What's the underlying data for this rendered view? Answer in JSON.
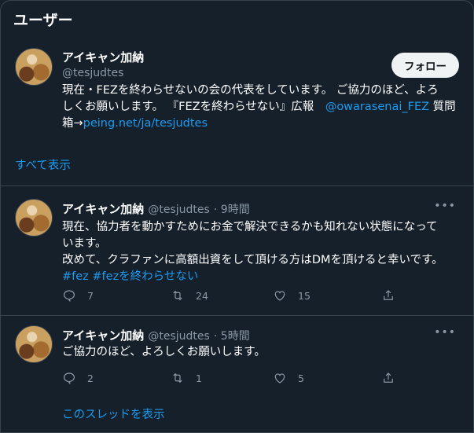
{
  "header": {
    "title": "ユーザー"
  },
  "profile": {
    "name": "アイキャン加納",
    "handle": "@tesjudtes",
    "follow_label": "フォロー",
    "bio_line1": "現在・FEZを終わらせないの会の代表をしています。 ご協力のほど、よろ",
    "bio_line2_a": "しくお願いします。 『FEZを終わらせない』広報　",
    "bio_mention": "@owarasenai_FEZ",
    "bio_line2_b": " 質問",
    "bio_line3_a": "箱→",
    "bio_link": "peing.net/ja/tesjudtes",
    "show_all": "すべて表示"
  },
  "tweets": [
    {
      "name": "アイキャン加納",
      "handle": "@tesjudtes",
      "time": "· 9時間",
      "lines": [
        "現在、協力者を動かすためにお金で解決できるかも知れない状態になって",
        "います。",
        "改めて、クラファンに高額出資をして頂ける方はDMを頂けると幸いです。"
      ],
      "hashtags": "#fez #fezを終わらせない",
      "replies": "7",
      "retweets": "24",
      "likes": "15"
    },
    {
      "name": "アイキャン加納",
      "handle": "@tesjudtes",
      "time": "· 5時間",
      "lines": [
        "ご協力のほど、よろしくお願いします。"
      ],
      "replies": "2",
      "retweets": "1",
      "likes": "5",
      "thread_link": "このスレッドを表示"
    }
  ],
  "icons": {
    "reply": "reply-icon",
    "retweet": "retweet-icon",
    "like": "heart-icon",
    "share": "share-icon",
    "more": "more-icon"
  }
}
